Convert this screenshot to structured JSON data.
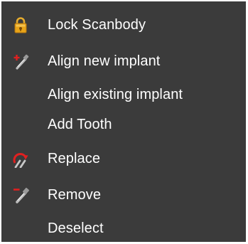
{
  "context_menu": {
    "items": [
      {
        "label": "Lock Scanbody",
        "icon": "lock-icon"
      },
      {
        "label": "Align new implant",
        "icon": "add-implant-icon"
      },
      {
        "label": "Align existing implant",
        "icon": ""
      },
      {
        "label": "Add Tooth",
        "icon": ""
      },
      {
        "label": "Replace",
        "icon": "replace-arrow-icon"
      },
      {
        "label": "Remove",
        "icon": "remove-implant-icon"
      },
      {
        "label": "Deselect",
        "icon": ""
      }
    ]
  },
  "colors": {
    "menu_background": "#3b3b3b",
    "text": "#ffffff",
    "lock_gold": "#e0a020",
    "accent_red": "#e02020"
  }
}
